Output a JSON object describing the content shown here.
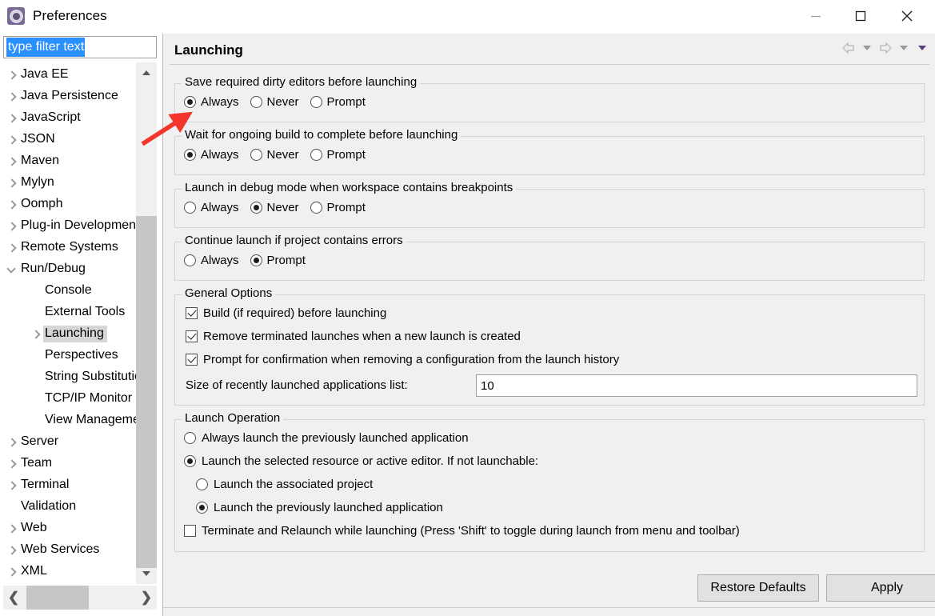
{
  "window": {
    "title": "Preferences",
    "icon": "gear-icon",
    "controls": {
      "minimize": "—",
      "maximize": "□",
      "close": "✕"
    }
  },
  "filter": {
    "value": "type filter text",
    "placeholder": "type filter text",
    "selection_color": "#2a8fff"
  },
  "tree": {
    "items": [
      {
        "label": "Java EE",
        "depth": 0,
        "arrow": "right",
        "selected": false
      },
      {
        "label": "Java Persistence",
        "depth": 0,
        "arrow": "right",
        "selected": false
      },
      {
        "label": "JavaScript",
        "depth": 0,
        "arrow": "right",
        "selected": false
      },
      {
        "label": "JSON",
        "depth": 0,
        "arrow": "right",
        "selected": false
      },
      {
        "label": "Maven",
        "depth": 0,
        "arrow": "right",
        "selected": false
      },
      {
        "label": "Mylyn",
        "depth": 0,
        "arrow": "right",
        "selected": false
      },
      {
        "label": "Oomph",
        "depth": 0,
        "arrow": "right",
        "selected": false
      },
      {
        "label": "Plug-in Development",
        "depth": 0,
        "arrow": "right",
        "selected": false
      },
      {
        "label": "Remote Systems",
        "depth": 0,
        "arrow": "right",
        "selected": false
      },
      {
        "label": "Run/Debug",
        "depth": 0,
        "arrow": "down",
        "selected": false
      },
      {
        "label": "Console",
        "depth": 1,
        "arrow": "none",
        "selected": false
      },
      {
        "label": "External Tools",
        "depth": 1,
        "arrow": "none",
        "selected": false
      },
      {
        "label": "Launching",
        "depth": 1,
        "arrow": "right",
        "selected": true
      },
      {
        "label": "Perspectives",
        "depth": 1,
        "arrow": "none",
        "selected": false
      },
      {
        "label": "String Substitution",
        "depth": 1,
        "arrow": "none",
        "selected": false
      },
      {
        "label": "TCP/IP Monitor",
        "depth": 1,
        "arrow": "none",
        "selected": false
      },
      {
        "label": "View Management",
        "depth": 1,
        "arrow": "none",
        "selected": false
      },
      {
        "label": "Server",
        "depth": 0,
        "arrow": "right",
        "selected": false
      },
      {
        "label": "Team",
        "depth": 0,
        "arrow": "right",
        "selected": false
      },
      {
        "label": "Terminal",
        "depth": 0,
        "arrow": "right",
        "selected": false
      },
      {
        "label": "Validation",
        "depth": 0,
        "arrow": "none",
        "selected": false
      },
      {
        "label": "Web",
        "depth": 0,
        "arrow": "right",
        "selected": false
      },
      {
        "label": "Web Services",
        "depth": 0,
        "arrow": "right",
        "selected": false
      },
      {
        "label": "XML",
        "depth": 0,
        "arrow": "right",
        "selected": false
      }
    ]
  },
  "page": {
    "title": "Launching",
    "nav": {
      "back": "back-arrow",
      "back_menu": "chevron-down",
      "forward": "forward-arrow",
      "forward_menu": "chevron-down",
      "view_menu": "chevron-down"
    }
  },
  "groups": {
    "save_dirty": {
      "label": "Save required dirty editors before launching",
      "options": [
        {
          "label": "Always",
          "checked": true
        },
        {
          "label": "Never",
          "checked": false
        },
        {
          "label": "Prompt",
          "checked": false
        }
      ]
    },
    "wait_build": {
      "label": "Wait for ongoing build to complete before launching",
      "options": [
        {
          "label": "Always",
          "checked": true
        },
        {
          "label": "Never",
          "checked": false
        },
        {
          "label": "Prompt",
          "checked": false
        }
      ]
    },
    "debug_breakpoints": {
      "label": "Launch in debug mode when workspace contains breakpoints",
      "options": [
        {
          "label": "Always",
          "checked": false
        },
        {
          "label": "Never",
          "checked": true
        },
        {
          "label": "Prompt",
          "checked": false
        }
      ]
    },
    "continue_errors": {
      "label": "Continue launch if project contains errors",
      "options": [
        {
          "label": "Always",
          "checked": false
        },
        {
          "label": "Prompt",
          "checked": true
        }
      ]
    },
    "general_options": {
      "label": "General Options",
      "checkboxes": [
        {
          "label": "Build (if required) before launching",
          "checked": true
        },
        {
          "label": "Remove terminated launches when a new launch is created",
          "checked": true
        },
        {
          "label": "Prompt for confirmation when removing a configuration from the launch history",
          "checked": true
        }
      ],
      "size_field_label": "Size of recently launched applications list:",
      "size_field_value": "10"
    },
    "launch_operation": {
      "label": "Launch Operation",
      "options": [
        {
          "label": "Always launch the previously launched application",
          "checked": false,
          "indent": false
        },
        {
          "label": "Launch the selected resource or active editor. If not launchable:",
          "checked": true,
          "indent": false
        },
        {
          "label": "Launch the associated project",
          "checked": false,
          "indent": true
        },
        {
          "label": "Launch the previously launched application",
          "checked": true,
          "indent": true
        }
      ],
      "terminate_checkbox": {
        "label": "Terminate and Relaunch while launching (Press 'Shift' to toggle during launch from menu and toolbar)",
        "checked": false
      }
    }
  },
  "buttons": {
    "restore_defaults": "Restore Defaults",
    "apply": "Apply"
  },
  "annotation": {
    "type": "arrow",
    "color": "#f4352c",
    "points_to": "save-dirty-always-radio"
  }
}
